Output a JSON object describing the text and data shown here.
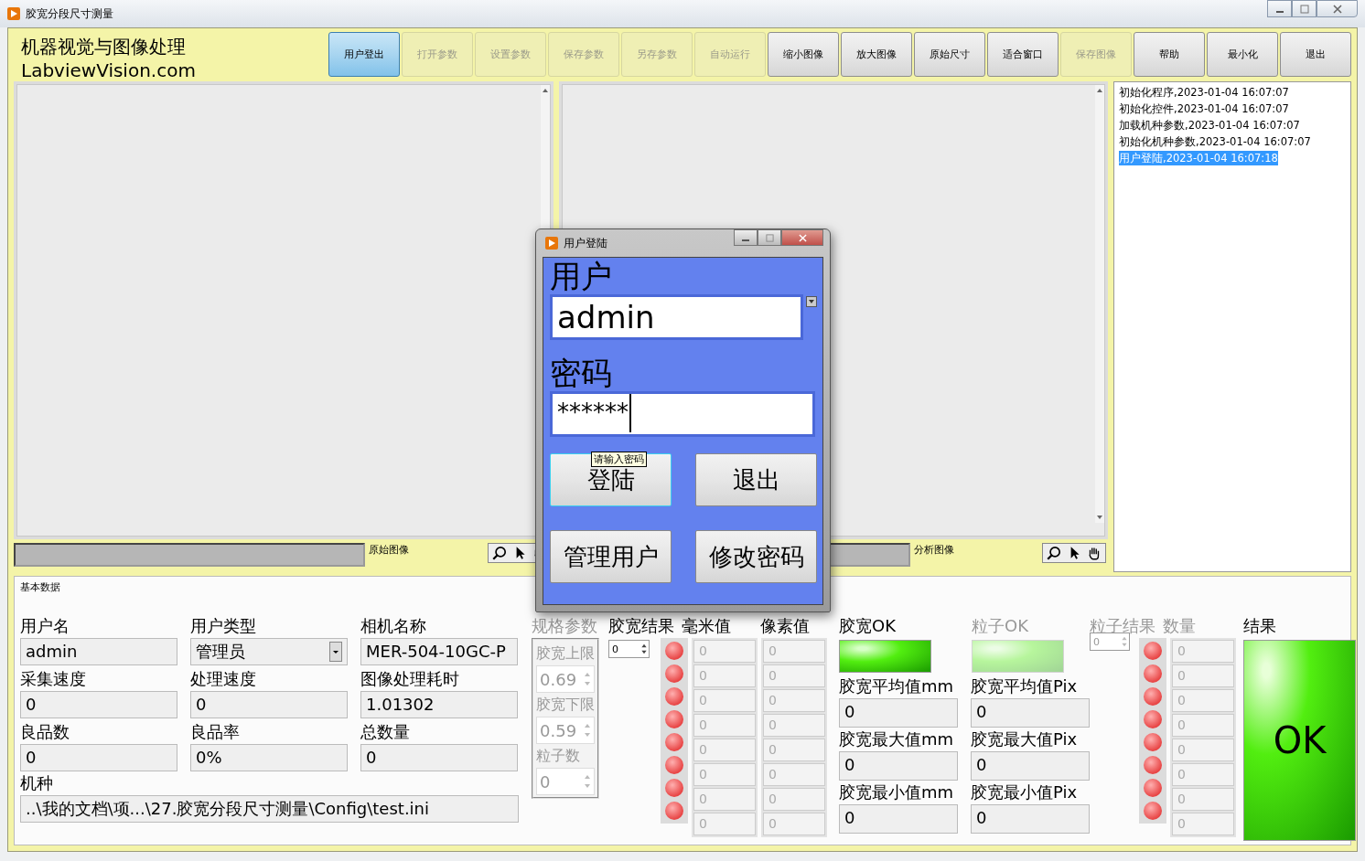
{
  "window": {
    "title": "胶宽分段尺寸测量"
  },
  "header": {
    "brand_line_1": "机器视觉与图像处理",
    "brand_line_2": "LabviewVision.com"
  },
  "toolbar": [
    {
      "label": "用户登出",
      "disabled": false,
      "selected": true
    },
    {
      "label": "打开参数",
      "disabled": true,
      "selected": false
    },
    {
      "label": "设置参数",
      "disabled": true,
      "selected": false
    },
    {
      "label": "保存参数",
      "disabled": true,
      "selected": false
    },
    {
      "label": "另存参数",
      "disabled": true,
      "selected": false
    },
    {
      "label": "自动运行",
      "disabled": true,
      "selected": false
    },
    {
      "label": "缩小图像",
      "disabled": false,
      "selected": false
    },
    {
      "label": "放大图像",
      "disabled": false,
      "selected": false
    },
    {
      "label": "原始尺寸",
      "disabled": false,
      "selected": false
    },
    {
      "label": "适合窗口",
      "disabled": false,
      "selected": false
    },
    {
      "label": "保存图像",
      "disabled": true,
      "selected": false
    },
    {
      "label": "帮助",
      "disabled": false,
      "selected": false
    },
    {
      "label": "最小化",
      "disabled": false,
      "selected": false
    },
    {
      "label": "退出",
      "disabled": false,
      "selected": false
    }
  ],
  "image_panels": [
    {
      "label": "原始图像"
    },
    {
      "label": "分析图像"
    }
  ],
  "log": [
    {
      "text": "初始化程序,2023-01-04 16:07:07",
      "selected": false
    },
    {
      "text": "初始化控件,2023-01-04 16:07:07",
      "selected": false
    },
    {
      "text": "加载机种参数,2023-01-04 16:07:07",
      "selected": false
    },
    {
      "text": "初始化机种参数,2023-01-04 16:07:07",
      "selected": false
    },
    {
      "text": "用户登陆,2023-01-04 16:07:18",
      "selected": true
    }
  ],
  "basic_data": {
    "title": "基本数据",
    "fields": [
      {
        "label": "用户名",
        "value": "admin",
        "kind": "text"
      },
      {
        "label": "用户类型",
        "value": "管理员",
        "kind": "dropdown"
      },
      {
        "label": "相机名称",
        "value": "MER-504-10GC-P",
        "kind": "text"
      },
      {
        "label": "采集速度",
        "value": "0",
        "kind": "text"
      },
      {
        "label": "处理速度",
        "value": "0",
        "kind": "text"
      },
      {
        "label": "图像处理耗时",
        "value": "1.01302",
        "kind": "text"
      },
      {
        "label": "良品数",
        "value": "0",
        "kind": "text"
      },
      {
        "label": "良品率",
        "value": "0%",
        "kind": "text"
      },
      {
        "label": "总数量",
        "value": "0",
        "kind": "text"
      }
    ],
    "recipe": {
      "label": "机种",
      "value": "..\\我的文档\\项...\\27.胶宽分段尺寸测量\\Config\\test.ini"
    }
  },
  "spec": {
    "title": "规格参数",
    "disabled": true,
    "items": [
      {
        "label": "胶宽上限",
        "value": "0.69"
      },
      {
        "label": "胶宽下限",
        "value": "0.59"
      },
      {
        "label": "粒子数",
        "value": "0"
      }
    ]
  },
  "width_results": {
    "labels": [
      "胶宽结果",
      "毫米值",
      "像素值"
    ],
    "index": "0",
    "rows": [
      {
        "on": false,
        "mm": "0",
        "pix": "0"
      },
      {
        "on": false,
        "mm": "0",
        "pix": "0"
      },
      {
        "on": false,
        "mm": "0",
        "pix": "0"
      },
      {
        "on": false,
        "mm": "0",
        "pix": "0"
      },
      {
        "on": false,
        "mm": "0",
        "pix": "0"
      },
      {
        "on": false,
        "mm": "0",
        "pix": "0"
      },
      {
        "on": false,
        "mm": "0",
        "pix": "0"
      },
      {
        "on": false,
        "mm": "0",
        "pix": "0"
      }
    ]
  },
  "indicators": [
    {
      "label": "胶宽OK",
      "on": true,
      "disabled": false
    },
    {
      "label": "粒子OK",
      "on": true,
      "disabled": true
    }
  ],
  "stats": [
    {
      "label": "胶宽平均值mm",
      "value": "0"
    },
    {
      "label": "胶宽平均值Pix",
      "value": "0"
    },
    {
      "label": "胶宽最大值mm",
      "value": "0"
    },
    {
      "label": "胶宽最大值Pix",
      "value": "0"
    },
    {
      "label": "胶宽最小值mm",
      "value": "0"
    },
    {
      "label": "胶宽最小值Pix",
      "value": "0"
    }
  ],
  "particle_results": {
    "label": "粒子结果",
    "count_label": "数量",
    "index": "0",
    "disabled": true,
    "rows": [
      {
        "on": false,
        "count": "0"
      },
      {
        "on": false,
        "count": "0"
      },
      {
        "on": false,
        "count": "0"
      },
      {
        "on": false,
        "count": "0"
      },
      {
        "on": false,
        "count": "0"
      },
      {
        "on": false,
        "count": "0"
      },
      {
        "on": false,
        "count": "0"
      },
      {
        "on": false,
        "count": "0"
      }
    ]
  },
  "result": {
    "label": "结果",
    "value": "OK",
    "ok": true
  },
  "dialog": {
    "title": "用户登陆",
    "user_label": "用户",
    "user_value": "admin",
    "password_label": "密码",
    "password_value": "******",
    "tooltip": "请输入密码",
    "buttons": [
      {
        "label": "登陆",
        "focused": true
      },
      {
        "label": "退出",
        "focused": false
      },
      {
        "label": "管理用户",
        "focused": false
      },
      {
        "label": "修改密码",
        "focused": false
      }
    ]
  }
}
